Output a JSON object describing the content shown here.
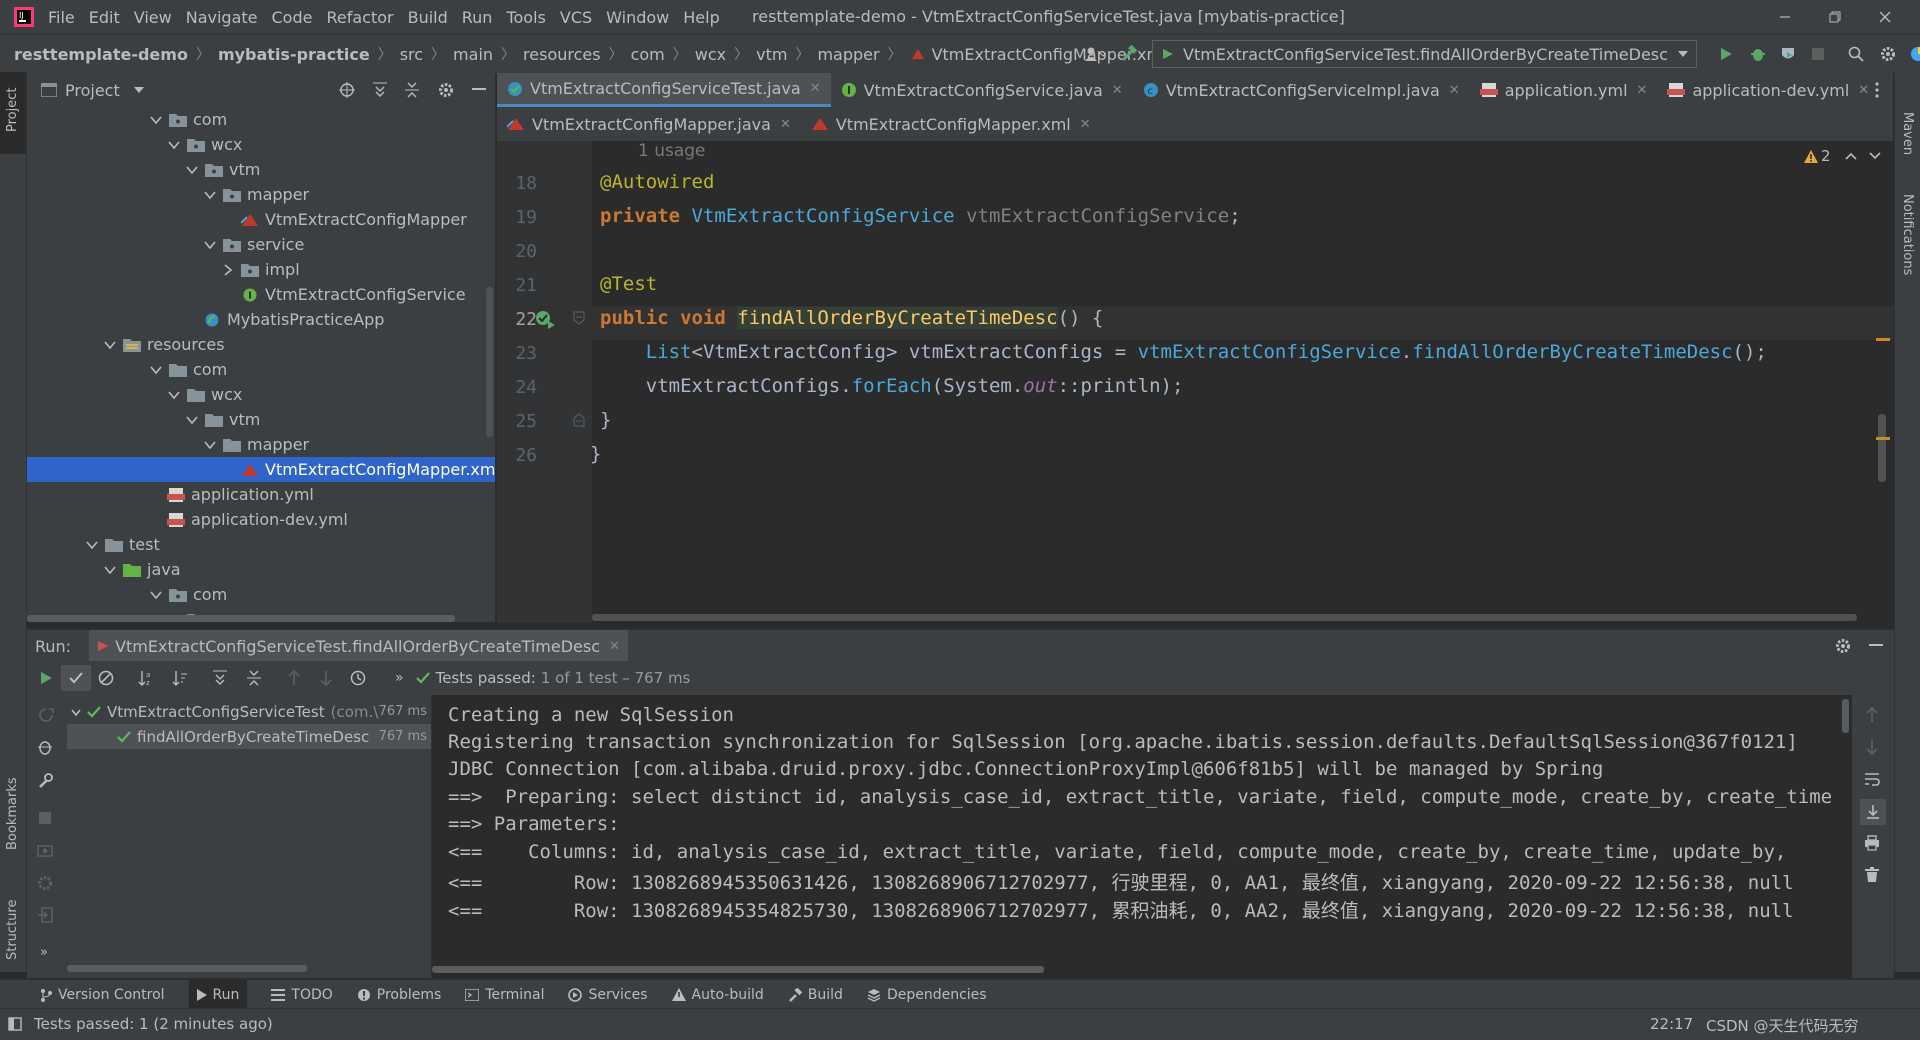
{
  "menu": [
    "File",
    "Edit",
    "View",
    "Navigate",
    "Code",
    "Refactor",
    "Build",
    "Run",
    "Tools",
    "VCS",
    "Window",
    "Help"
  ],
  "window_title": "resttemplate-demo - VtmExtractConfigServiceTest.java [mybatis-practice]",
  "breadcrumb": [
    "resttemplate-demo",
    "mybatis-practice",
    "src",
    "main",
    "resources",
    "com",
    "wcx",
    "vtm",
    "mapper",
    "VtmExtractConfigMapper.xml"
  ],
  "run_config": "VtmExtractConfigServiceTest.findAllOrderByCreateTimeDesc",
  "left_stripe": {
    "project": "Project",
    "bookmarks": "Bookmarks",
    "structure": "Structure"
  },
  "right_stripe": {
    "maven": "Maven",
    "notifications": "Notifications"
  },
  "project_panel": {
    "title": "Project"
  },
  "tree": [
    {
      "label": "com",
      "indent": 4
    },
    {
      "label": "wcx",
      "indent": 5
    },
    {
      "label": "vtm",
      "indent": 6
    },
    {
      "label": "mapper",
      "indent": 7
    },
    {
      "label": "VtmExtractConfigMapper",
      "indent": 8
    },
    {
      "label": "service",
      "indent": 7
    },
    {
      "label": "impl",
      "indent": 8
    },
    {
      "label": "VtmExtractConfigService",
      "indent": 8
    },
    {
      "label": "MybatisPracticeApp",
      "indent": 7
    },
    {
      "label": "resources",
      "indent": 3
    },
    {
      "label": "com",
      "indent": 4
    },
    {
      "label": "wcx",
      "indent": 5
    },
    {
      "label": "vtm",
      "indent": 6
    },
    {
      "label": "mapper",
      "indent": 7
    },
    {
      "label": "VtmExtractConfigMapper.xm",
      "indent": 8
    },
    {
      "label": "application.yml",
      "indent": 5
    },
    {
      "label": "application-dev.yml",
      "indent": 5
    },
    {
      "label": "test",
      "indent": 2
    },
    {
      "label": "java",
      "indent": 3
    },
    {
      "label": "com",
      "indent": 4
    },
    {
      "label": "wcx",
      "indent": 5
    }
  ],
  "tabs_row1": [
    "VtmExtractConfigServiceTest.java",
    "VtmExtractConfigService.java",
    "VtmExtractConfigServiceImpl.java",
    "application.yml",
    "application-dev.yml"
  ],
  "tabs_row2": [
    "VtmExtractConfigMapper.java",
    "VtmExtractConfigMapper.xml"
  ],
  "editor": {
    "usage_hint": "1 usage",
    "warnings": "2",
    "line_numbers": [
      "18",
      "19",
      "20",
      "21",
      "22",
      "23",
      "24",
      "25",
      "26"
    ]
  },
  "run": {
    "label": "Run:",
    "tab": "VtmExtractConfigServiceTest.findAllOrderByCreateTimeDesc",
    "status_bold": "Tests passed:",
    "status_rest": "1 of 1 test – 767 ms",
    "tree": [
      {
        "label": "VtmExtractConfigServiceTest",
        "suffix": "(com.\\",
        "time": "767 ms"
      },
      {
        "label": "findAllOrderByCreateTimeDesc",
        "suffix": "",
        "time": "767 ms"
      }
    ],
    "console": [
      "Creating a new SqlSession",
      "Registering transaction synchronization for SqlSession [org.apache.ibatis.session.defaults.DefaultSqlSession@367f0121]",
      "JDBC Connection [com.alibaba.druid.proxy.jdbc.ConnectionProxyImpl@606f81b5] will be managed by Spring",
      "==>  Preparing: select distinct id, analysis_case_id, extract_title, variate, field, compute_mode, create_by, create_time",
      "==> Parameters: ",
      "<==    Columns: id, analysis_case_id, extract_title, variate, field, compute_mode, create_by, create_time, update_by,",
      "<==        Row: 1308268945350631426, 1308268906712702977, 行驶里程, 0, AA1, 最终值, xiangyang, 2020-09-22 12:56:38, null",
      "<==        Row: 1308268945354825730, 1308268906712702977, 累积油耗, 0, AA2, 最终值, xiangyang, 2020-09-22 12:56:38, null"
    ]
  },
  "toolwindows": [
    "Version Control",
    "Run",
    "TODO",
    "Problems",
    "Terminal",
    "Services",
    "Auto-build",
    "Build",
    "Dependencies"
  ],
  "statusbar": {
    "message": "Tests passed: 1 (2 minutes ago)",
    "time": "22:17",
    "watermark": "CSDN @天生代码无穷"
  },
  "colors": {
    "accent": "#2f65ca",
    "pass": "#5fb85f",
    "run": "#59a869",
    "warning": "#e5a83b"
  }
}
